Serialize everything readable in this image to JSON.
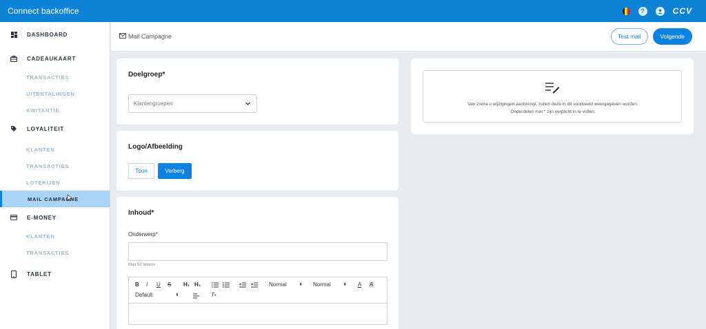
{
  "app": {
    "title": "Connect backoffice",
    "brand": "CCV"
  },
  "topbar_icons": [
    "belgium-flag-icon",
    "help-icon",
    "user-icon"
  ],
  "sidebar": {
    "sections": [
      {
        "label": "DASHBOARD",
        "icon": "dashboard-icon",
        "items": []
      },
      {
        "label": "CADEAUKAART",
        "icon": "giftcard-icon",
        "items": [
          "TRANSACTIES",
          "UITBETALINGEN",
          "KWITANTIE"
        ]
      },
      {
        "label": "LOYALITEIT",
        "icon": "tag-icon",
        "items": [
          "KLANTEN",
          "TRANSACTIES",
          "LOTERIJEN",
          "MAIL CAMPAGNE"
        ]
      },
      {
        "label": "E-MONEY",
        "icon": "card-icon",
        "items": [
          "KLANTEN",
          "TRANSACTIES"
        ]
      },
      {
        "label": "TABLET",
        "icon": "tablet-icon",
        "items": []
      }
    ],
    "active_item": "MAIL CAMPAGNE"
  },
  "header": {
    "breadcrumb": "Mail Campagne",
    "test_mail": "Test mail",
    "next": "Volgende"
  },
  "doelgroep": {
    "title": "Doelgroep*",
    "select_value": "Klantengroepen"
  },
  "logo": {
    "title": "Logo/Afbeelding",
    "show": "Toon",
    "hide": "Verberg",
    "selected": "Verberg"
  },
  "inhoud": {
    "title": "Inhoud*",
    "subject_label": "Onderwerp*",
    "subject_value": "",
    "subject_hint": "Max 50 tekens",
    "toolbar": {
      "bold": "B",
      "italic": "I",
      "underline": "U",
      "strike": "S",
      "h1": "H₁",
      "h2": "H₂",
      "format1": "Normal",
      "format2": "Normal",
      "font": "Default"
    }
  },
  "preview": {
    "line1": "Van zodra u wijzigingen aanbrengt, zullen deze in dit voorbeeld weergegeven worden.",
    "line2": "Onderdelen met * zijn verplicht in te vullen."
  },
  "colors": {
    "accent": "#0c83d6",
    "active_bg": "#a9d4f5"
  }
}
